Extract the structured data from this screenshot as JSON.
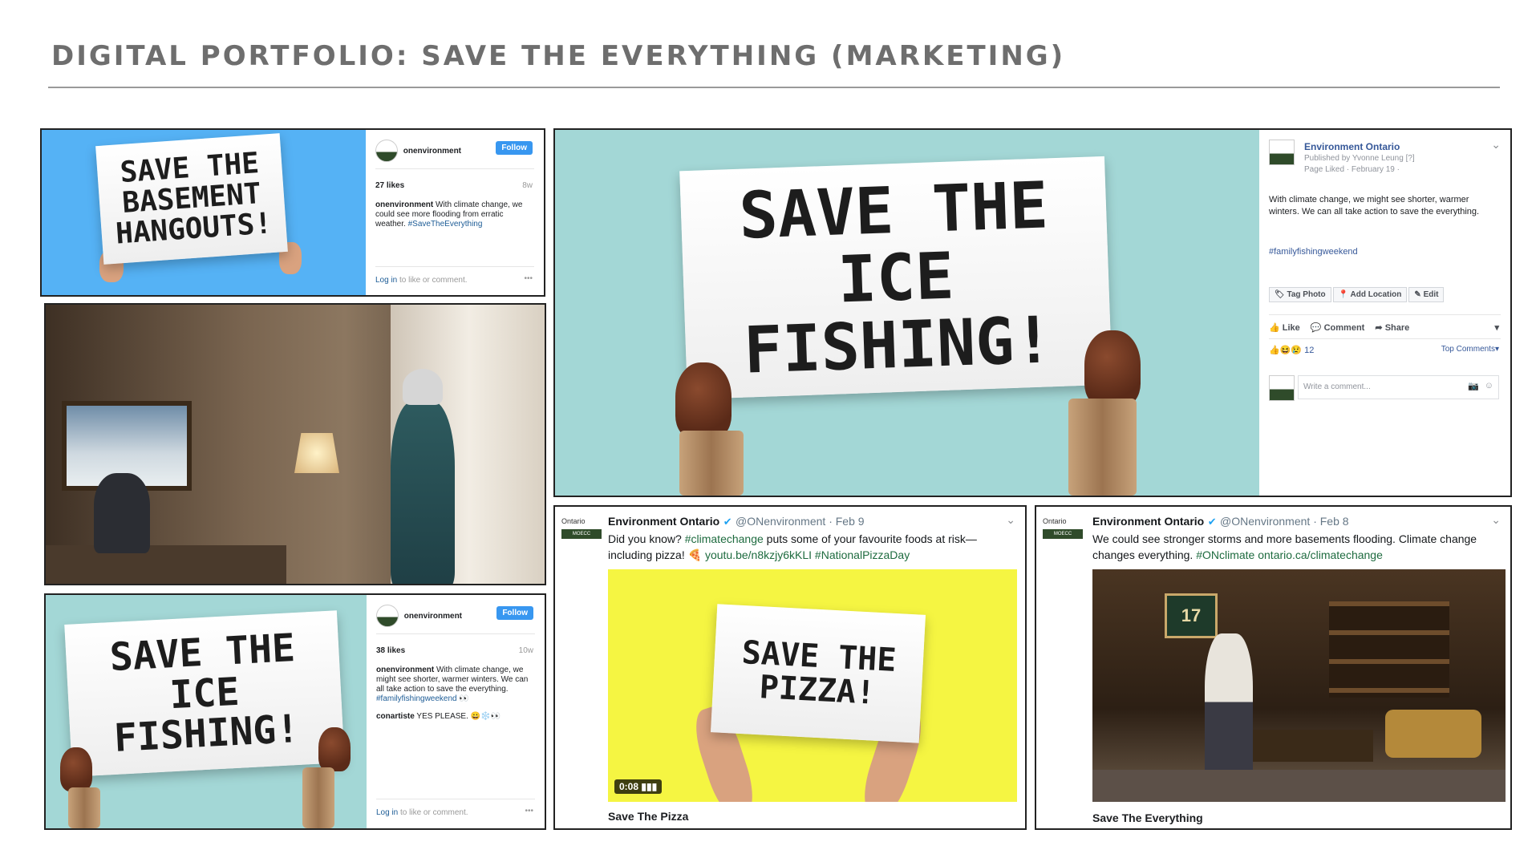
{
  "page": {
    "title": "DIGITAL PORTFOLIO: SAVE THE EVERYTHING (MARKETING)"
  },
  "ig1": {
    "sign": "SAVE THE\nBASEMENT\nHANGOUTS!",
    "username": "onenvironment",
    "follow": "Follow",
    "likes": "27 likes",
    "age": "8w",
    "caption_user": "onenvironment",
    "caption": "With climate change, we could see more flooding from erratic weather.",
    "hashtag": "#SaveTheEverything",
    "login": "Log in",
    "login_rest": "to like or comment.",
    "more": "•••"
  },
  "ig2": {
    "sign": "SAVE THE\nICE FISHING!",
    "username": "onenvironment",
    "follow": "Follow",
    "likes": "38 likes",
    "age": "10w",
    "caption_user": "onenvironment",
    "caption": "With climate change, we might see shorter, warmer winters. We can all take action to save the everything.",
    "hashtag": "#familyfishingweekend",
    "comment_user": "conartiste",
    "comment": "YES PLEASE.",
    "login": "Log in",
    "login_rest": "to like or comment.",
    "more": "•••"
  },
  "fb": {
    "sign": "SAVE THE\nICE FISHING!",
    "page_name": "Environment Ontario",
    "published": "Published by Yvonne Leung [?]",
    "date": "Page Liked · February 19 ·",
    "text": "With climate change, we might see shorter, warmer winters. We can all take action to save the everything.",
    "hashtag": "#familyfishingweekend",
    "tag_photo": "Tag Photo",
    "add_location": "Add Location",
    "edit": "Edit",
    "like": "Like",
    "comment": "Comment",
    "share": "Share",
    "reaction_count": "12",
    "top_comments": "Top Comments",
    "write_comment": "Write a comment..."
  },
  "tw1": {
    "name": "Environment Ontario",
    "handle": "@ONenvironment · Feb 9",
    "text_a": "Did you know?",
    "tag1": "#climatechange",
    "text_b": "puts some of your favourite foods at risk—including pizza! 🍕",
    "link": "youtu.be/n8kzjy6kKLI",
    "tag2": "#NationalPizzaDay",
    "sign": "SAVE THE\nPIZZA!",
    "duration": "0:08",
    "caption": "Save The Pizza"
  },
  "tw2": {
    "name": "Environment Ontario",
    "handle": "@ONenvironment · Feb 8",
    "text": "We could see stronger storms and more basements flooding. Climate change changes everything.",
    "tag": "#ONclimate",
    "link": "ontario.ca/climatechange",
    "jersey": "17",
    "caption": "Save The Everything"
  },
  "logo": {
    "text": "Ontario",
    "sub": "MOECC"
  },
  "colors": {
    "ig_blue": "#55b2f5",
    "teal": "#a3d7d6",
    "pizza_yellow": "#f5f542",
    "tw_green": "#1e6b3f",
    "fb_blue": "#365899"
  }
}
